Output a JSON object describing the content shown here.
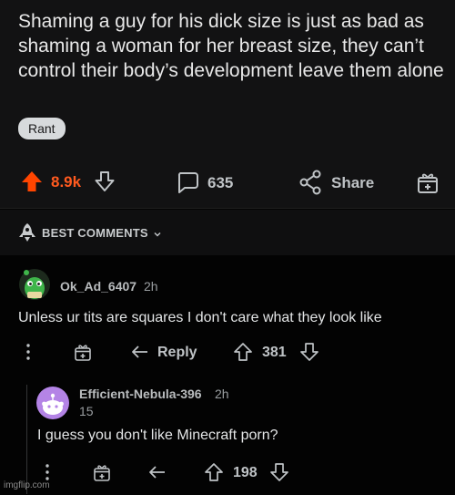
{
  "post": {
    "title": "Shaming a guy for his dick size is just as bad as shaming a woman for her breast size, they can’t control their body’s development leave them alone",
    "flair": "Rant",
    "score": "8.9k",
    "comments_count": "635",
    "share_label": "Share"
  },
  "section": {
    "label": "BEST COMMENTS"
  },
  "comments": [
    {
      "username": "Ok_Ad_6407",
      "time": "2h",
      "text": "Unless ur tits are squares I don't care what they look like",
      "reply_label": "Reply",
      "score": "381"
    },
    {
      "username": "Efficient-Nebula-396",
      "time": "2h",
      "flair_line": "15",
      "text": "I guess you don't like Minecraft porn?",
      "score": "198"
    }
  ],
  "watermark": "imgflip.com",
  "colors": {
    "upvote": "#ff4500",
    "background": "#030303",
    "post_bg": "#121213",
    "text": "#d7dadc"
  }
}
